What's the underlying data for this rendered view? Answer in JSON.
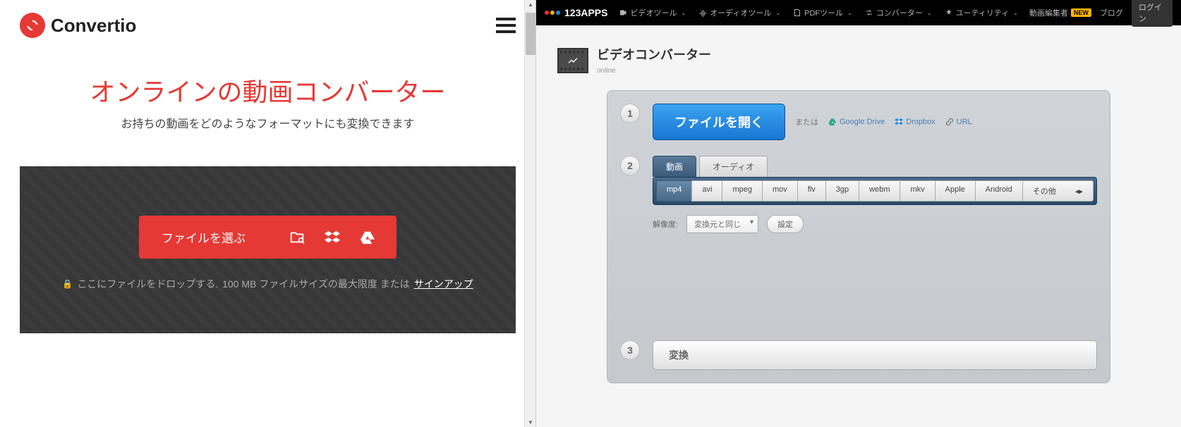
{
  "left": {
    "brand": "Convertio",
    "title": "オンラインの動画コンバーター",
    "subtitle": "お持ちの動画をどのようなフォーマットにも変換できます",
    "file_button": "ファイルを選ぶ",
    "drop_prefix": "ここにファイルをドロップする.",
    "size_limit": "100 MB ファイルサイズの最大限度 または",
    "signup": "サインアップ"
  },
  "right": {
    "brand": "123APPS",
    "nav": {
      "video": "ビデオツール",
      "audio": "オーディオツール",
      "pdf": "PDFツール",
      "converter": "コンバーター",
      "utility": "ユーティリティ",
      "editor": "動画編集者",
      "new": "NEW",
      "blog": "ブログ",
      "login": "ログイン"
    },
    "page_title": "ビデオコンバーター",
    "page_sub": "online",
    "step1": {
      "num": "1",
      "open": "ファイルを開く",
      "or": "または",
      "gdrive": "Google Drive",
      "dropbox": "Dropbox",
      "url": "URL"
    },
    "step2": {
      "num": "2",
      "tab_video": "動画",
      "tab_audio": "オーディオ",
      "formats": [
        "mp4",
        "avi",
        "mpeg",
        "mov",
        "flv",
        "3gp",
        "webm",
        "mkv",
        "Apple",
        "Android",
        "その他"
      ],
      "res_label": "解像度:",
      "res_value": "変換元と同じ",
      "settings": "設定"
    },
    "step3": {
      "num": "3",
      "convert": "変換"
    }
  }
}
